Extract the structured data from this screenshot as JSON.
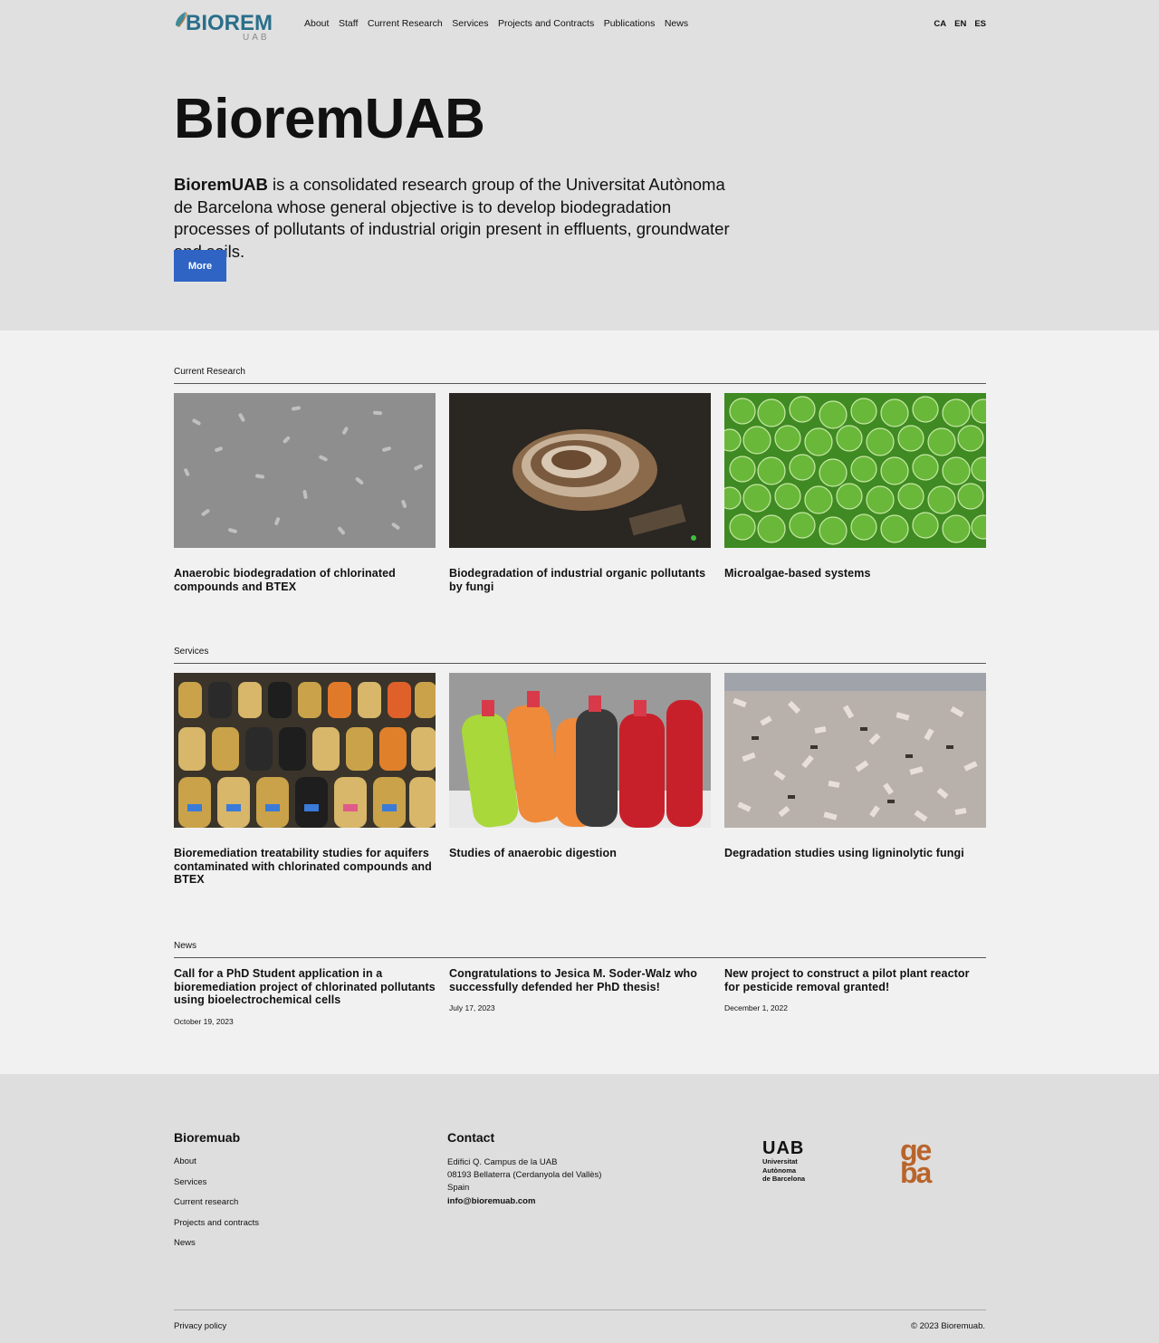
{
  "header": {
    "logo_text": "BIOREM",
    "logo_subtext": "UAB",
    "nav": [
      "About",
      "Staff",
      "Current Research",
      "Services",
      "Projects and Contracts",
      "Publications",
      "News"
    ],
    "langs": [
      "CA",
      "EN",
      "ES"
    ]
  },
  "hero": {
    "title": "BioremUAB",
    "intro_bold": "BioremUAB",
    "intro_rest": " is a consolidated research group of the Universitat Autònoma de Barcelona whose general objective is to develop biodegradation processes of pollutants of industrial origin present in effluents, groundwater and soils.",
    "more_label": "More"
  },
  "research": {
    "label": "Current Research",
    "items": [
      {
        "title": "Anaerobic biodegradation of chlorinated compounds and BTEX"
      },
      {
        "title": "Biodegradation of industrial organic pollutants by fungi"
      },
      {
        "title": "Microalgae-based systems"
      }
    ]
  },
  "services": {
    "label": "Services",
    "items": [
      {
        "title": "Bioremediation treatability studies for aquifers contaminated with chlorinated compounds and BTEX"
      },
      {
        "title": "Studies of anaerobic digestion"
      },
      {
        "title": "Degradation studies using ligninolytic fungi"
      }
    ]
  },
  "news": {
    "label": "News",
    "items": [
      {
        "title": "Call for a PhD Student application in a bioremediation project of chlorinated pollutants using bioelectrochemical cells",
        "date": "October 19, 2023"
      },
      {
        "title": "Congratulations to Jesica M. Soder-Walz who successfully defended her PhD thesis!",
        "date": "July 17, 2023"
      },
      {
        "title": "New project to construct a pilot plant reactor for pesticide removal granted!",
        "date": "December 1, 2022"
      }
    ]
  },
  "footer": {
    "brand_title": "Bioremuab",
    "links": [
      "About",
      "Services",
      "Current research",
      "Projects and contracts",
      "News"
    ],
    "contact_title": "Contact",
    "address": [
      "Edifici Q. Campus de la UAB",
      "08193 Bellaterra (Cerdanyola del Vallès)",
      "Spain"
    ],
    "email": "info@bioremuab.com",
    "uab_logo_lines": [
      "UAB",
      "Universitat",
      "Autònoma",
      "de Barcelona"
    ],
    "geba_logo_text": [
      "ge",
      "ba"
    ],
    "privacy": "Privacy policy",
    "copyright": "© 2023 Bioremuab."
  },
  "colors": {
    "accent": "#2f64c4",
    "hero_bg": "#e0e0e0",
    "body_bg": "#f1f1f1",
    "geba_orange": "#b9642a"
  }
}
